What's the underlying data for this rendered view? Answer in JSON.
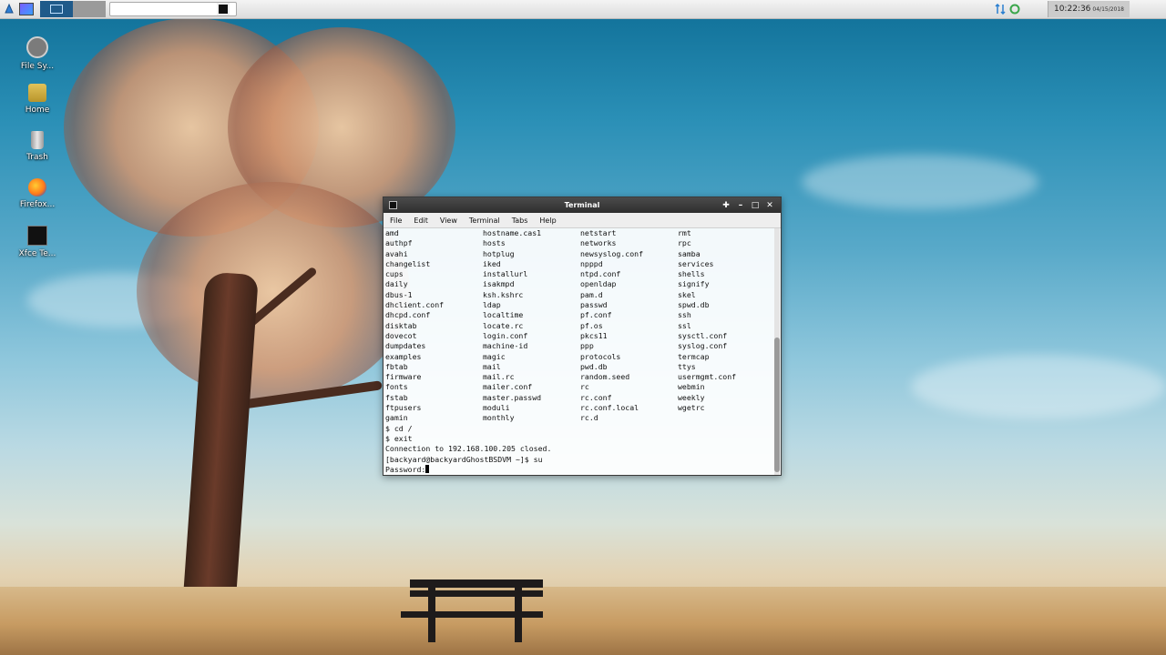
{
  "panel": {
    "clock_time": "10:22:36",
    "clock_date": "04/15/2018"
  },
  "desktop_icons": [
    {
      "label": "File Sy...",
      "icon": "filesystem-icon"
    },
    {
      "label": "Home",
      "icon": "home-folder-icon"
    },
    {
      "label": "Trash",
      "icon": "trash-icon"
    },
    {
      "label": "Firefox...",
      "icon": "firefox-icon"
    },
    {
      "label": "Xfce Te...",
      "icon": "terminal-icon"
    }
  ],
  "terminal": {
    "title": "Terminal",
    "menu": [
      "File",
      "Edit",
      "View",
      "Terminal",
      "Tabs",
      "Help"
    ],
    "columns": [
      [
        "amd",
        "authpf",
        "avahi",
        "changelist",
        "cups",
        "daily",
        "dbus-1",
        "dhclient.conf",
        "dhcpd.conf",
        "disktab",
        "dovecot",
        "dumpdates",
        "examples",
        "fbtab",
        "firmware",
        "fonts",
        "fstab",
        "ftpusers",
        "gamin"
      ],
      [
        "hostname.cas1",
        "hosts",
        "hotplug",
        "iked",
        "installurl",
        "isakmpd",
        "ksh.kshrc",
        "ldap",
        "localtime",
        "locate.rc",
        "login.conf",
        "machine-id",
        "magic",
        "mail",
        "mail.rc",
        "mailer.conf",
        "master.passwd",
        "moduli",
        "monthly"
      ],
      [
        "netstart",
        "networks",
        "newsyslog.conf",
        "npppd",
        "ntpd.conf",
        "openldap",
        "pam.d",
        "passwd",
        "pf.conf",
        "pf.os",
        "pkcs11",
        "ppp",
        "protocols",
        "pwd.db",
        "random.seed",
        "rc",
        "rc.conf",
        "rc.conf.local",
        "rc.d"
      ],
      [
        "rmt",
        "rpc",
        "samba",
        "services",
        "shells",
        "signify",
        "skel",
        "spwd.db",
        "ssh",
        "ssl",
        "sysctl.conf",
        "syslog.conf",
        "termcap",
        "ttys",
        "usermgmt.conf",
        "webmin",
        "weekly",
        "wgetrc",
        ""
      ]
    ],
    "after_lines": [
      "$ cd /",
      "$ exit",
      "Connection to 192.168.100.205 closed.",
      "[backyard@backyardGhostBSDVM ~]$ su"
    ],
    "prompt": "Password:"
  }
}
